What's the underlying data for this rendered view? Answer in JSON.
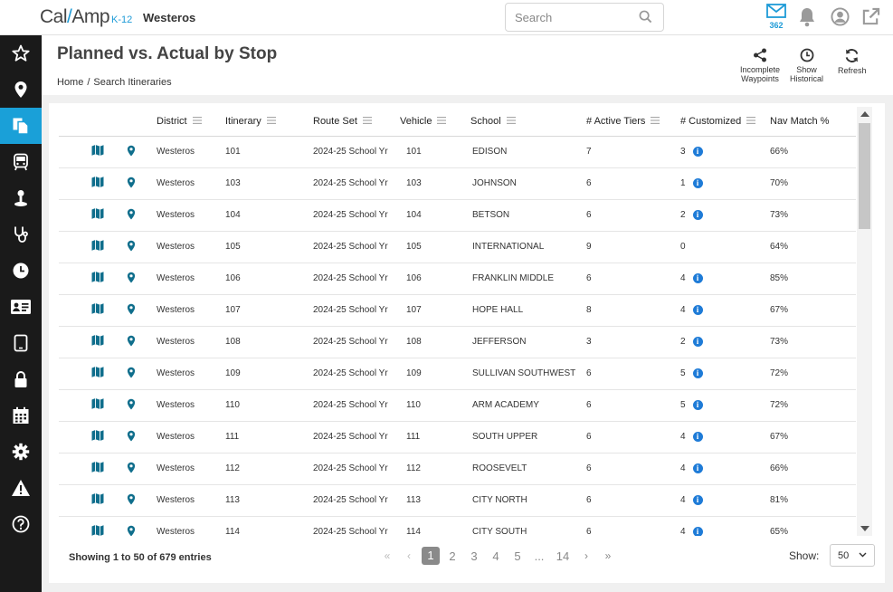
{
  "app": {
    "logo_left": "Cal",
    "logo_slash": "/",
    "logo_right": "Amp",
    "logo_suffix": "K-12",
    "brand": "Westeros"
  },
  "search": {
    "placeholder": "Search"
  },
  "notifications": {
    "mail_count": "362"
  },
  "page": {
    "title": "Planned vs. Actual by Stop",
    "breadcrumb": [
      "Home",
      "/",
      "Search Itineraries"
    ]
  },
  "actions": [
    {
      "label_line1": "Incomplete",
      "label_line2": "Waypoints",
      "icon": "share-icon"
    },
    {
      "label_line1": "Show",
      "label_line2": "Historical",
      "icon": "clock-icon"
    },
    {
      "label_line1": "Refresh",
      "label_line2": "",
      "icon": "refresh-icon"
    }
  ],
  "sidebar": [
    {
      "icon": "star-icon"
    },
    {
      "icon": "map-pin-icon"
    },
    {
      "icon": "documents-icon",
      "active": true
    },
    {
      "icon": "bus-icon"
    },
    {
      "icon": "student-icon"
    },
    {
      "icon": "stethoscope-icon"
    },
    {
      "icon": "clock-icon"
    },
    {
      "icon": "id-card-icon"
    },
    {
      "icon": "tablet-icon"
    },
    {
      "icon": "lock-icon"
    },
    {
      "icon": "calendar-icon"
    },
    {
      "icon": "gear-icon"
    },
    {
      "icon": "warning-icon"
    },
    {
      "icon": "help-icon"
    }
  ],
  "table": {
    "columns": [
      "District",
      "Itinerary",
      "Route Set",
      "Vehicle",
      "School",
      "# Active Tiers",
      "# Customized",
      "Nav Match %"
    ],
    "rows": [
      [
        "Westeros",
        "101",
        "2024-25 School Yr",
        "101",
        "EDISON",
        "7",
        "3",
        "66%"
      ],
      [
        "Westeros",
        "103",
        "2024-25 School Yr",
        "103",
        "JOHNSON",
        "6",
        "1",
        "70%"
      ],
      [
        "Westeros",
        "104",
        "2024-25 School Yr",
        "104",
        "BETSON",
        "6",
        "2",
        "73%"
      ],
      [
        "Westeros",
        "105",
        "2024-25 School Yr",
        "105",
        "INTERNATIONAL",
        "9",
        "0",
        "64%"
      ],
      [
        "Westeros",
        "106",
        "2024-25 School Yr",
        "106",
        "FRANKLIN MIDDLE",
        "6",
        "4",
        "85%"
      ],
      [
        "Westeros",
        "107",
        "2024-25 School Yr",
        "107",
        "HOPE HALL",
        "8",
        "4",
        "67%"
      ],
      [
        "Westeros",
        "108",
        "2024-25 School Yr",
        "108",
        "JEFFERSON",
        "3",
        "2",
        "73%"
      ],
      [
        "Westeros",
        "109",
        "2024-25 School Yr",
        "109",
        "SULLIVAN SOUTHWEST",
        "6",
        "5",
        "72%"
      ],
      [
        "Westeros",
        "110",
        "2024-25 School Yr",
        "110",
        "ARM ACADEMY",
        "6",
        "5",
        "72%"
      ],
      [
        "Westeros",
        "111",
        "2024-25 School Yr",
        "111",
        "SOUTH UPPER",
        "6",
        "4",
        "67%"
      ],
      [
        "Westeros",
        "112",
        "2024-25 School Yr",
        "112",
        "ROOSEVELT",
        "6",
        "4",
        "66%"
      ],
      [
        "Westeros",
        "113",
        "2024-25 School Yr",
        "113",
        "CITY NORTH",
        "6",
        "4",
        "81%"
      ],
      [
        "Westeros",
        "114",
        "2024-25 School Yr",
        "114",
        "CITY SOUTH",
        "6",
        "4",
        "65%"
      ]
    ],
    "info_glyph": "i"
  },
  "footer": {
    "entries_text": "Showing 1 to 50 of 679 entries",
    "pager": {
      "first": "«",
      "prev": "‹",
      "pages": [
        "1",
        "2",
        "3",
        "4",
        "5",
        "...",
        "14"
      ],
      "current": "1",
      "next": "›",
      "last": "»"
    },
    "show_label": "Show:",
    "show_value": "50"
  },
  "colors": {
    "accent": "#1aa0d8",
    "map_icon": "#0f6e8c",
    "info_icon": "#1e7bd7",
    "sidebar_bg": "#1a1a1a"
  }
}
